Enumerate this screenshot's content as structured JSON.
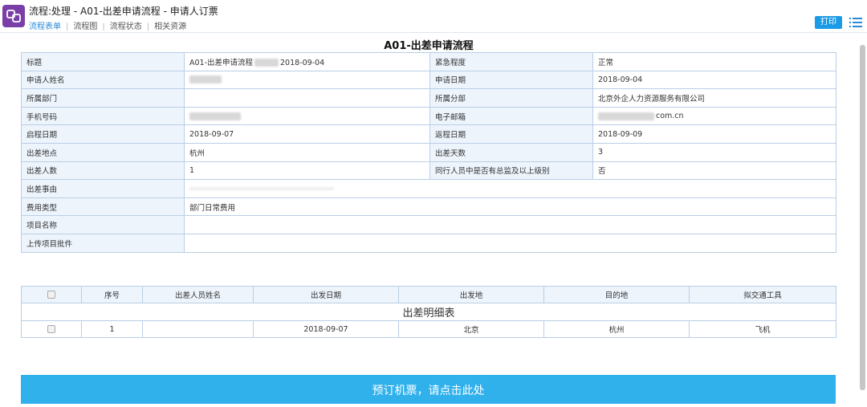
{
  "header": {
    "title": "流程:处理 - A01-出差申请流程 - 申请人订票",
    "tabs": [
      {
        "label": "流程表单"
      },
      {
        "label": "流程图"
      },
      {
        "label": "流程状态"
      },
      {
        "label": "相关资源"
      }
    ],
    "print_label": "打印"
  },
  "form": {
    "title": "A01-出差申请流程",
    "rows": [
      {
        "l1": "标题",
        "v1a": "A01-出差申请流程",
        "v1b": "2018-09-04",
        "l2": "紧急程度",
        "v2": "正常"
      },
      {
        "l1": "申请人姓名",
        "v1": "",
        "l2": "申请日期",
        "v2": "2018-09-04"
      },
      {
        "l1": "所属部门",
        "v1": "",
        "l2": "所属分部",
        "v2": "北京外企人力资源服务有限公司"
      },
      {
        "l1": "手机号码",
        "v1": "",
        "l2": "电子邮箱",
        "v2": "com.cn"
      },
      {
        "l1": "启程日期",
        "v1": "2018-09-07",
        "l2": "返程日期",
        "v2": "2018-09-09"
      },
      {
        "l1": "出差地点",
        "v1": "杭州",
        "l2": "出差天数",
        "v2": "3"
      },
      {
        "l1": "出差人数",
        "v1": "1",
        "l2": "同行人员中是否有总监及以上级别",
        "v2": "否"
      },
      {
        "l1": "出差事由",
        "v1": ""
      },
      {
        "l1": "费用类型",
        "v1": "部门日常费用"
      },
      {
        "l1": "项目名称",
        "v1": ""
      },
      {
        "l1": "上传项目批件",
        "v1": ""
      }
    ]
  },
  "detail": {
    "title": "出差明细表",
    "headers": [
      "序号",
      "出差人员姓名",
      "出发日期",
      "出发地",
      "目的地",
      "拟交通工具"
    ],
    "rows": [
      {
        "seq": "1",
        "name": "",
        "date": "2018-09-07",
        "from": "北京",
        "to": "杭州",
        "transport": "飞机"
      }
    ]
  },
  "book_button": {
    "label": "预订机票，请点击此处"
  },
  "colors": {
    "accent": "#1a9be6",
    "logo": "#7a3ea8",
    "label_bg": "#edf4fc",
    "border": "#b9cfe6",
    "book_button": "#31b1ec"
  }
}
